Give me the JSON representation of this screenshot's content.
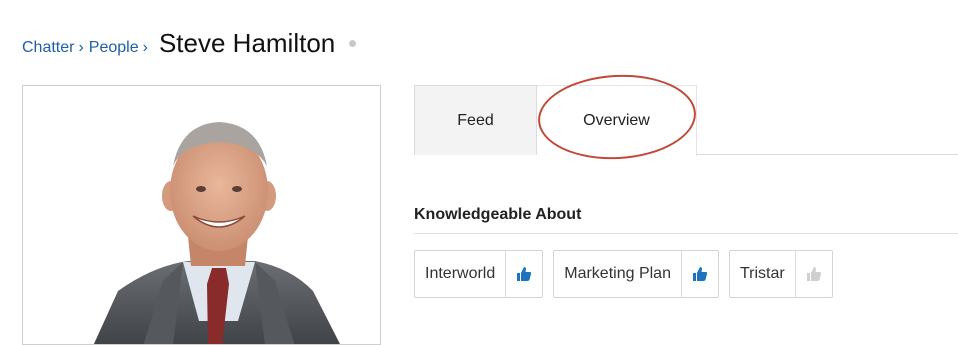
{
  "breadcrumb": {
    "items": [
      {
        "label": "Chatter"
      },
      {
        "label": "People"
      }
    ],
    "separator": "›",
    "title": "Steve Hamilton",
    "presence": "offline"
  },
  "tabs": [
    {
      "label": "Feed",
      "active": false
    },
    {
      "label": "Overview",
      "active": true
    }
  ],
  "knowledge": {
    "heading": "Knowledgeable About",
    "topics": [
      {
        "label": "Interworld",
        "endorsed": true
      },
      {
        "label": "Marketing Plan",
        "endorsed": true
      },
      {
        "label": "Tristar",
        "endorsed": false
      }
    ]
  },
  "colors": {
    "link": "#1f5fa8",
    "endorse_active": "#1e73be",
    "endorse_inactive": "#cfcfcf",
    "annotation": "#c0493a"
  },
  "profile_photo": {
    "icon": "person-photo"
  }
}
